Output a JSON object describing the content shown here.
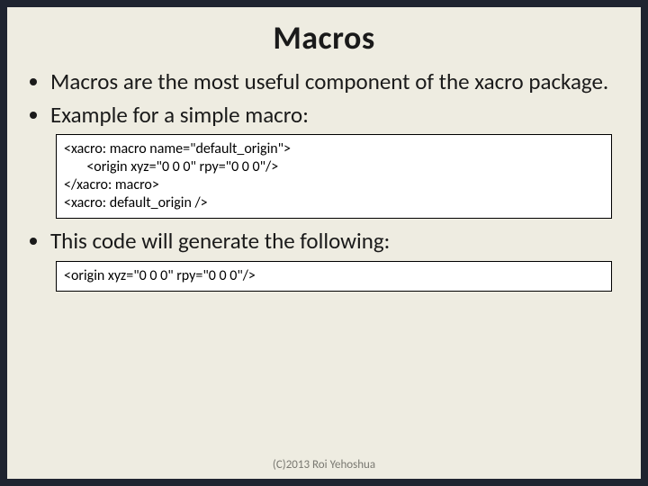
{
  "title": "Macros",
  "bullets": {
    "b1": "Macros are the most useful component of the xacro package.",
    "b2": "Example for a simple macro:",
    "b3": "This code will generate the following:"
  },
  "code": {
    "box1": "<xacro: macro name=\"default_origin\">\n       <origin xyz=\"0 0 0\" rpy=\"0 0 0\"/>\n</xacro: macro>\n<xacro: default_origin />",
    "box2": "<origin xyz=\"0 0 0\" rpy=\"0 0 0\"/>"
  },
  "footer": "(C)2013 Roi Yehoshua"
}
